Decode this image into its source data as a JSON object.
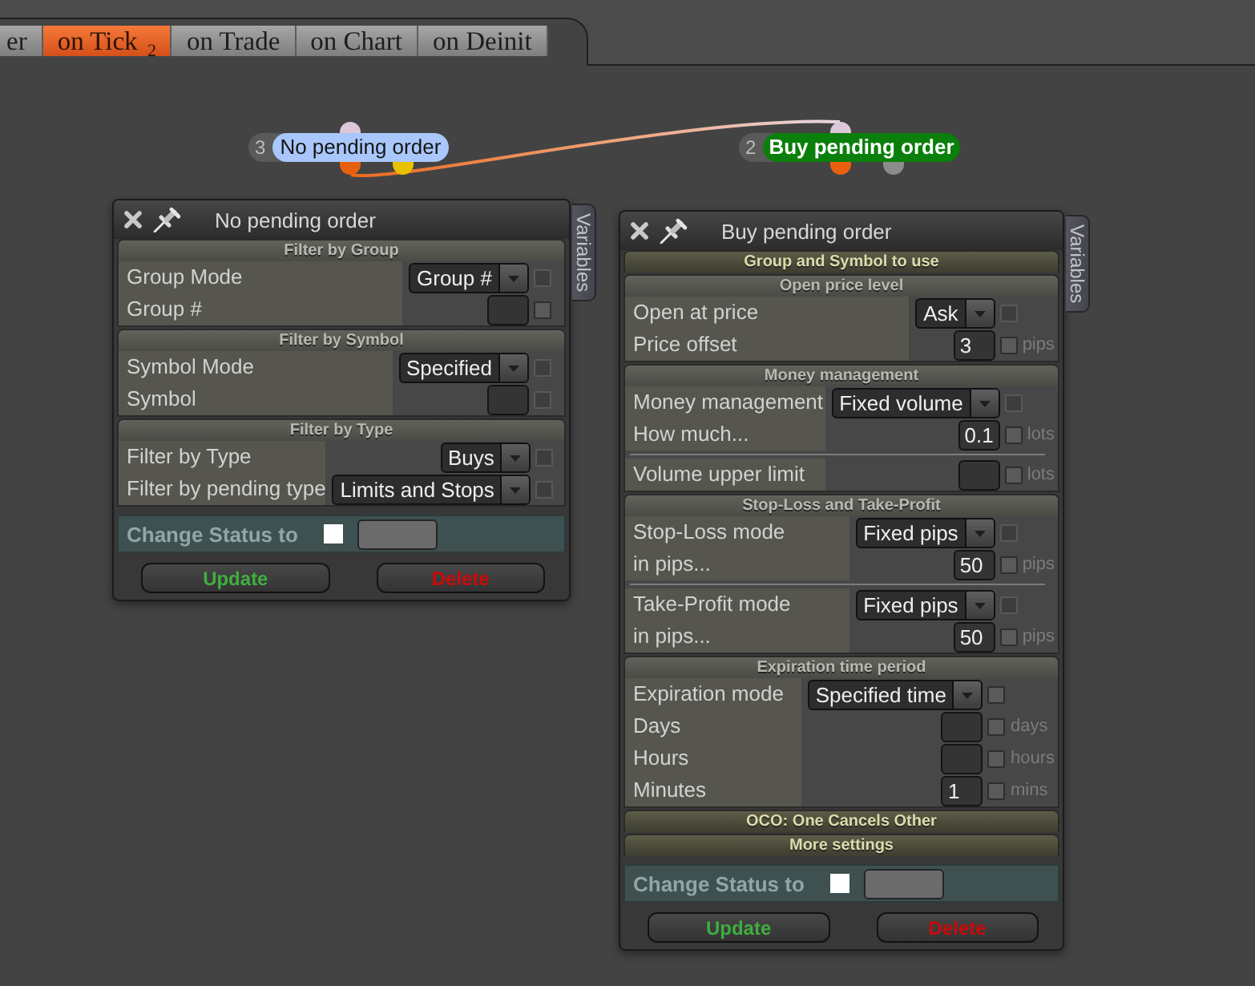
{
  "tabs": [
    {
      "label": "er",
      "selected": false
    },
    {
      "label": "on Tick $_{2}$",
      "selected": true
    },
    {
      "label": "on Trade",
      "selected": false
    },
    {
      "label": "on Chart",
      "selected": false
    },
    {
      "label": "on Deinit",
      "selected": false
    }
  ],
  "nodes": [
    {
      "number": "3",
      "label": "No pending order",
      "kind": "condition",
      "color": "#a9c7fb",
      "inputs": [
        {
          "color": "#dcc8d9"
        }
      ],
      "outputs": [
        {
          "color": "#e8600d"
        },
        {
          "color": "#e8c200"
        }
      ]
    },
    {
      "number": "2",
      "label": "Buy pending order",
      "kind": "action",
      "color": "#0b7f0b",
      "inputs": [
        {
          "color": "#dcc8d9"
        }
      ],
      "outputs": [
        {
          "color": "#e8600d"
        },
        {
          "color": "#8c8c8c"
        }
      ]
    }
  ],
  "panels": [
    {
      "title": "No pending order",
      "side_tab": "Variables",
      "sections": [
        {
          "title": "Filter by Group",
          "expanded": true,
          "groups": [
            {
              "rows": [
                {
                  "label": "Group Mode",
                  "kind": "dropdown",
                  "value": "Group #",
                  "check": {
                    "checked": false,
                    "disabled": true
                  }
                },
                {
                  "label": "Group #",
                  "kind": "field",
                  "check": {
                    "checked": false,
                    "disabled": false
                  }
                }
              ]
            }
          ]
        },
        {
          "title": "Filter by Symbol",
          "expanded": true,
          "groups": [
            {
              "rows": [
                {
                  "label": "Symbol Mode",
                  "kind": "dropdown",
                  "value": "Specified",
                  "check": {
                    "checked": false,
                    "disabled": true
                  }
                },
                {
                  "label": "Symbol",
                  "kind": "field",
                  "check": {
                    "checked": false,
                    "disabled": true
                  }
                }
              ]
            }
          ]
        },
        {
          "title": "Filter by Type",
          "expanded": true,
          "groups": [
            {
              "rows": [
                {
                  "label": "Filter by Type",
                  "kind": "dropdown",
                  "value": "Buys",
                  "check": {
                    "checked": false,
                    "disabled": true
                  }
                },
                {
                  "label": "Filter by pending type",
                  "kind": "dropdown",
                  "value": "Limits and Stops",
                  "check": {
                    "checked": false,
                    "disabled": true
                  }
                }
              ]
            }
          ]
        }
      ],
      "status": {
        "label": "Change Status to",
        "checked": false
      },
      "buttons": [
        {
          "label": "Update",
          "kind": "update"
        },
        {
          "label": "Delete",
          "kind": "delete"
        }
      ]
    },
    {
      "title": "Buy pending order",
      "side_tab": "Variables",
      "sections": [
        {
          "title": "Group and Symbol to use",
          "expanded": false
        },
        {
          "title": "Open price level",
          "expanded": true,
          "groups": [
            {
              "rows": [
                {
                  "label": "Open at price",
                  "kind": "dropdown",
                  "value": "Ask",
                  "check": {
                    "checked": false,
                    "disabled": true
                  }
                },
                {
                  "label": "Price offset",
                  "kind": "field",
                  "value": "3",
                  "check": {
                    "checked": false,
                    "disabled": false
                  },
                  "unit": "pips"
                }
              ]
            }
          ]
        },
        {
          "title": "Money management",
          "expanded": true,
          "groups": [
            {
              "rows": [
                {
                  "label": "Money management",
                  "kind": "dropdown",
                  "value": "Fixed volume",
                  "check": {
                    "checked": false,
                    "disabled": true
                  }
                },
                {
                  "label": "How much...",
                  "kind": "field",
                  "value": "0.1",
                  "check": {
                    "checked": false,
                    "disabled": false
                  },
                  "unit": "lots"
                }
              ]
            },
            {
              "rows": [
                {
                  "label": "Volume upper limit",
                  "kind": "field",
                  "check": {
                    "checked": false,
                    "disabled": false
                  },
                  "unit": "lots"
                }
              ]
            }
          ]
        },
        {
          "title": "Stop-Loss and Take-Profit",
          "expanded": true,
          "groups": [
            {
              "rows": [
                {
                  "label": "Stop-Loss mode",
                  "kind": "dropdown",
                  "value": "Fixed pips",
                  "check": {
                    "checked": false,
                    "disabled": true
                  }
                },
                {
                  "label": "in pips...",
                  "kind": "field",
                  "value": "50",
                  "check": {
                    "checked": false,
                    "disabled": false
                  },
                  "unit": "pips"
                }
              ]
            },
            {
              "rows": [
                {
                  "label": "Take-Profit mode",
                  "kind": "dropdown",
                  "value": "Fixed pips",
                  "check": {
                    "checked": false,
                    "disabled": true
                  }
                },
                {
                  "label": "in pips...",
                  "kind": "field",
                  "value": "50",
                  "check": {
                    "checked": false,
                    "disabled": false
                  },
                  "unit": "pips"
                }
              ]
            }
          ]
        },
        {
          "title": "Expiration time period",
          "expanded": true,
          "groups": [
            {
              "rows": [
                {
                  "label": "Expiration mode",
                  "kind": "dropdown",
                  "value": "Specified time",
                  "check": {
                    "checked": false,
                    "disabled": false
                  }
                },
                {
                  "label": "Days",
                  "kind": "field",
                  "check": {
                    "checked": false,
                    "disabled": false
                  },
                  "unit": "days"
                },
                {
                  "label": "Hours",
                  "kind": "field",
                  "check": {
                    "checked": false,
                    "disabled": false
                  },
                  "unit": "hours"
                },
                {
                  "label": "Minutes",
                  "kind": "field",
                  "value": "1",
                  "check": {
                    "checked": false,
                    "disabled": false
                  },
                  "unit": "mins"
                }
              ]
            }
          ]
        },
        {
          "title": "OCO: One Cancels Other",
          "expanded": false
        },
        {
          "title": "More settings",
          "expanded": false
        }
      ],
      "status": {
        "label": "Change Status to",
        "checked": false
      },
      "buttons": [
        {
          "label": "Update",
          "kind": "update"
        },
        {
          "label": "Delete",
          "kind": "delete"
        }
      ]
    }
  ]
}
